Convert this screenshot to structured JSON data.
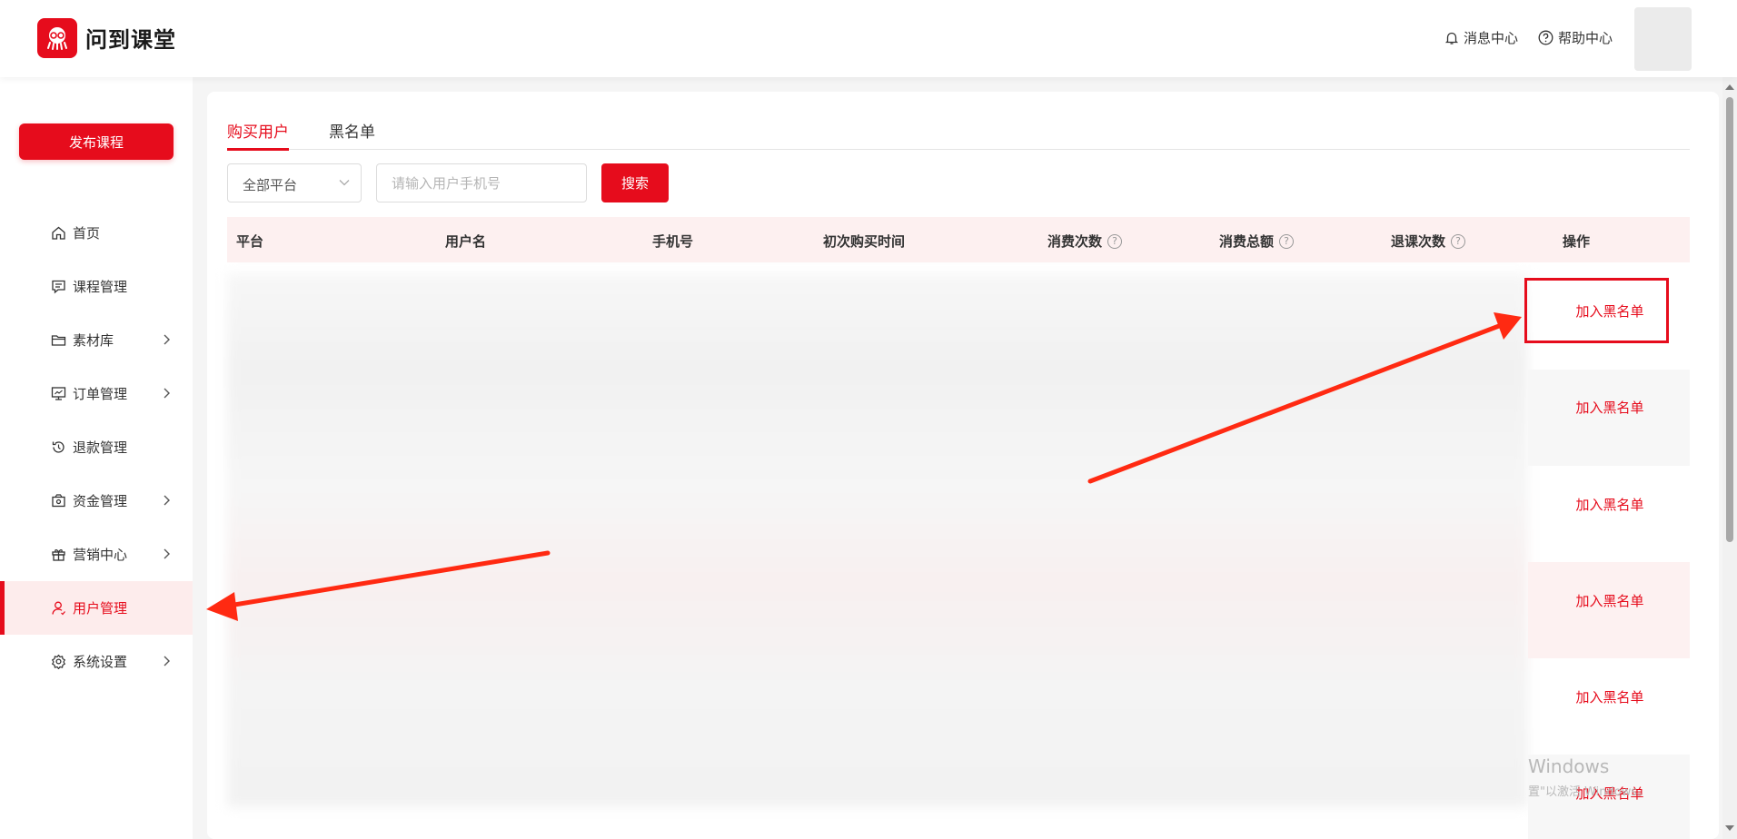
{
  "header": {
    "app_name": "问到课堂",
    "messages_label": "消息中心",
    "help_label": "帮助中心"
  },
  "sidebar": {
    "publish_label": "发布课程",
    "items": [
      {
        "label": "首页",
        "icon": "home-icon"
      },
      {
        "label": "课程管理",
        "icon": "chat-icon"
      },
      {
        "label": "素材库",
        "icon": "folder-icon"
      },
      {
        "label": "订单管理",
        "icon": "monitor-icon"
      },
      {
        "label": "退款管理",
        "icon": "refund-icon"
      },
      {
        "label": "资金管理",
        "icon": "wallet-icon"
      },
      {
        "label": "营销中心",
        "icon": "gift-icon"
      },
      {
        "label": "用户管理",
        "icon": "user-icon",
        "active": true
      },
      {
        "label": "系统设置",
        "icon": "gear-icon"
      }
    ]
  },
  "tabs": [
    "购买用户",
    "黑名单"
  ],
  "filters": {
    "platform_selected": "全部平台",
    "phone_placeholder": "请输入用户手机号",
    "search_label": "搜索"
  },
  "table": {
    "columns": [
      "平台",
      "用户名",
      "手机号",
      "初次购买时间",
      "消费次数",
      "消费总额",
      "退课次数",
      "操作"
    ],
    "row_action": "加入黑名单",
    "row_count": 6
  },
  "watermark": {
    "line1": "Windows",
    "line2": "置\"以激活 Windows。"
  },
  "colors": {
    "brand": "#e60c1c",
    "header_row_bg": "#fdf0f0"
  }
}
